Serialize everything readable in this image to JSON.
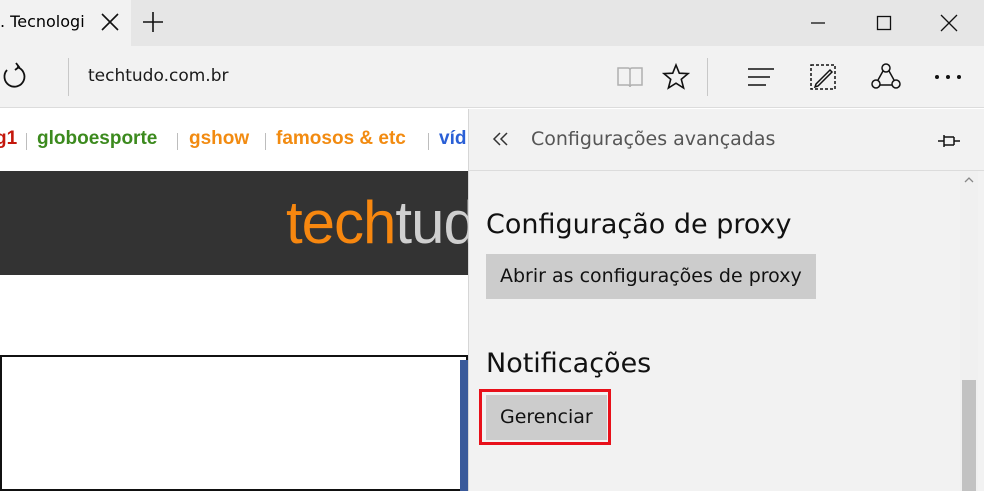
{
  "tab": {
    "title": ". Tecnologi"
  },
  "address": {
    "url": "techtudo.com.br"
  },
  "favorites": [
    {
      "label": "g1",
      "color": "#c4170c"
    },
    {
      "label": "globoesporte",
      "color": "#3c8a1e"
    },
    {
      "label": "gshow",
      "color": "#f28b11"
    },
    {
      "label": "famosos & etc",
      "color": "#f28b11"
    },
    {
      "label": "víd",
      "color": "#2a5fd6"
    }
  ],
  "banner": {
    "logo_part1": "tech",
    "logo_part2": "tudo"
  },
  "panel": {
    "title": "Configurações avançadas",
    "proxy_heading": "Configuração de proxy",
    "proxy_button": "Abrir as configurações de proxy",
    "notifications_heading": "Notificações",
    "manage_button": "Gerenciar"
  },
  "colors": {
    "highlight": "#e8101a",
    "banner_bg": "#333333",
    "logo_orange": "#f7870f"
  },
  "icons": [
    "close-icon",
    "plus-icon",
    "minimize-icon",
    "maximize-icon",
    "refresh-icon",
    "reading-view-icon",
    "star-icon",
    "hub-icon",
    "web-note-icon",
    "share-icon",
    "more-icon",
    "back-chevron-icon",
    "pin-icon"
  ]
}
